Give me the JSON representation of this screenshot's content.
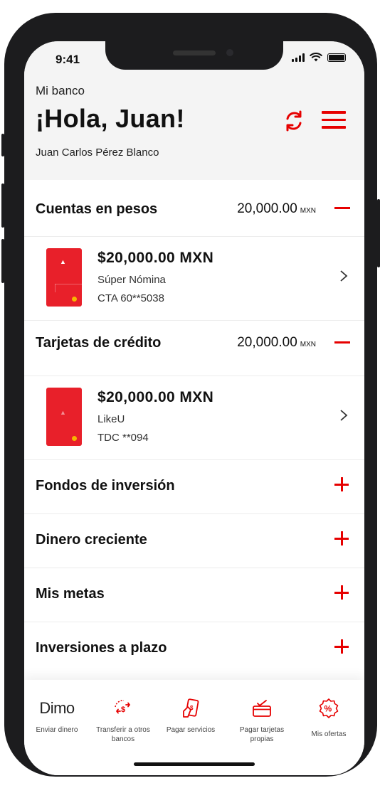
{
  "status_bar": {
    "time": "9:41"
  },
  "header": {
    "bank_label": "Mi banco",
    "greeting": "¡Hola, Juan!",
    "full_name": "Juan Carlos Pérez Blanco",
    "refresh_icon": "refresh-icon",
    "menu_icon": "hamburger-menu-icon"
  },
  "sections": [
    {
      "title": "Cuentas en pesos",
      "amount": "20,000.00",
      "currency": "MXN",
      "accounts": [
        {
          "amount": "$20,000.00 MXN",
          "name": "Súper Nómina",
          "number": "CTA 60**5038"
        }
      ]
    },
    {
      "title": "Tarjetas de crédito",
      "amount": "20,000.00",
      "currency": "MXN",
      "accounts": [
        {
          "amount": "$20,000.00 MXN",
          "name": "LikeU",
          "number": "TDC **094"
        }
      ]
    }
  ],
  "products": [
    {
      "title": "Fondos de inversión"
    },
    {
      "title": "Dinero creciente"
    },
    {
      "title": "Mis metas"
    },
    {
      "title": "Inversiones a plazo"
    }
  ],
  "tabbar": {
    "items": [
      {
        "logo": "Dimo",
        "label": "Enviar dinero",
        "icon": "dimo-logo"
      },
      {
        "label": "Transferir a otros bancos",
        "icon": "transfer-icon"
      },
      {
        "label": "Pagar servicios",
        "icon": "pay-services-icon"
      },
      {
        "label": "Pagar tarjetas propias",
        "icon": "pay-cards-icon"
      },
      {
        "label": "Mis ofertas",
        "icon": "offers-icon"
      }
    ]
  },
  "colors": {
    "accent": "#e60000",
    "card": "#e8202a",
    "header_bg": "#f4f4f4"
  }
}
